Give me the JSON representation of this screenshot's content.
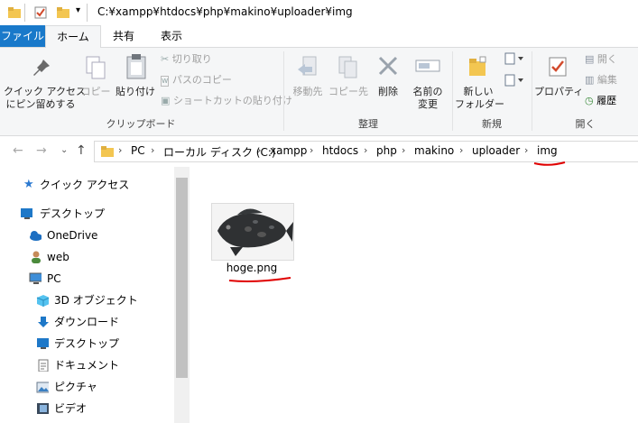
{
  "window": {
    "path": "C:¥xampp¥htdocs¥php¥makino¥uploader¥img"
  },
  "tabs": [
    {
      "label": "ファイル"
    },
    {
      "label": "ホーム"
    },
    {
      "label": "共有"
    },
    {
      "label": "表示"
    }
  ],
  "ribbon": {
    "clipboard": {
      "pin_line1": "クイック アクセス",
      "pin_line2": "にピン留めする",
      "copy": "コピー",
      "paste": "貼り付け",
      "cut": "切り取り",
      "copy_path": "パスのコピー",
      "paste_shortcut": "ショートカットの貼り付け",
      "group": "クリップボード"
    },
    "organize": {
      "move_to": "移動先",
      "copy_to": "コピー先",
      "delete": "削除",
      "rename_line1": "名前の",
      "rename_line2": "変更",
      "group": "整理"
    },
    "new": {
      "new_folder_line1": "新しい",
      "new_folder_line2": "フォルダー",
      "group": "新規"
    },
    "open": {
      "properties": "プロパティ",
      "open": "開く",
      "edit": "編集",
      "history": "履歴",
      "group": "開く"
    }
  },
  "address": {
    "crumbs": [
      "PC",
      "ローカル ディスク (C:)",
      "xampp",
      "htdocs",
      "php",
      "makino",
      "uploader",
      "img"
    ]
  },
  "nav_pane": {
    "items": [
      {
        "label": "クイック アクセス",
        "icon": "star-icon"
      },
      {
        "label": "デスクトップ",
        "icon": "desktop-icon"
      },
      {
        "label": "OneDrive",
        "icon": "cloud-icon"
      },
      {
        "label": "web",
        "icon": "user-icon"
      },
      {
        "label": "PC",
        "icon": "pc-icon"
      },
      {
        "label": "3D オブジェクト",
        "icon": "cube-icon"
      },
      {
        "label": "ダウンロード",
        "icon": "download-icon"
      },
      {
        "label": "デスクトップ",
        "icon": "desktop-icon"
      },
      {
        "label": "ドキュメント",
        "icon": "document-icon"
      },
      {
        "label": "ピクチャ",
        "icon": "picture-icon"
      },
      {
        "label": "ビデオ",
        "icon": "video-icon"
      }
    ]
  },
  "files": [
    {
      "name": "hoge.png"
    }
  ],
  "colors": {
    "accent": "#1979ca",
    "annotation": "#e00000"
  }
}
